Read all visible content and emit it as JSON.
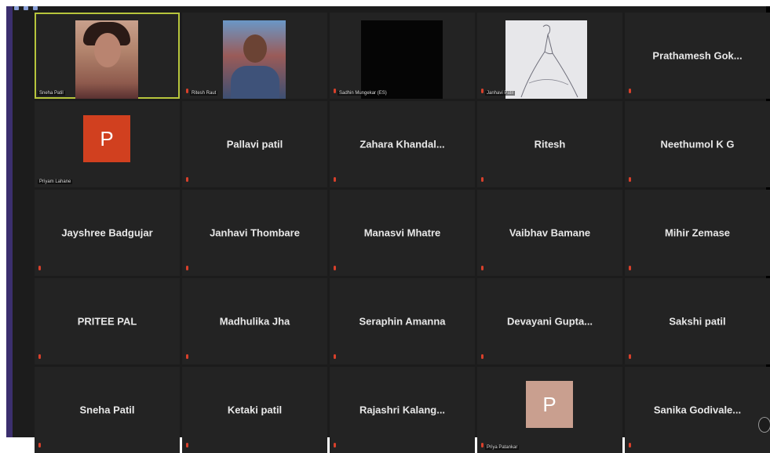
{
  "participants": [
    {
      "name": "",
      "label": "Sneha Patil",
      "type": "video",
      "video": "face",
      "active": true,
      "muted": false
    },
    {
      "name": "",
      "label": "Ritesh Raut",
      "type": "video",
      "video": "man",
      "active": false,
      "muted": true
    },
    {
      "name": "",
      "label": "Sadhin Mungekar (ES)",
      "type": "video",
      "video": "black",
      "active": false,
      "muted": true
    },
    {
      "name": "",
      "label": "Janhavi Patil",
      "type": "video",
      "video": "sketch",
      "active": false,
      "muted": true
    },
    {
      "name": "Prathamesh Gok...",
      "label": "",
      "type": "name",
      "muted": true
    },
    {
      "name": "",
      "label": "Priyam Lahane",
      "type": "avatar",
      "avatar_letter": "P",
      "avatar_color": "#d1401f",
      "muted": false
    },
    {
      "name": "Pallavi patil",
      "label": "",
      "type": "name",
      "muted": true
    },
    {
      "name": "Zahara Khandal...",
      "label": "",
      "type": "name",
      "muted": true
    },
    {
      "name": "Ritesh",
      "label": "",
      "type": "name",
      "muted": true
    },
    {
      "name": "Neethumol K G",
      "label": "",
      "type": "name",
      "muted": true
    },
    {
      "name": "Jayshree Badgujar",
      "label": "",
      "type": "name",
      "muted": true
    },
    {
      "name": "Janhavi Thombare",
      "label": "",
      "type": "name",
      "muted": true
    },
    {
      "name": "Manasvi Mhatre",
      "label": "",
      "type": "name",
      "muted": true
    },
    {
      "name": "Vaibhav Bamane",
      "label": "",
      "type": "name",
      "muted": true
    },
    {
      "name": "Mihir Zemase",
      "label": "",
      "type": "name",
      "muted": true
    },
    {
      "name": "PRITEE PAL",
      "label": "",
      "type": "name",
      "muted": true
    },
    {
      "name": "Madhulika Jha",
      "label": "",
      "type": "name",
      "muted": true
    },
    {
      "name": "Seraphin Amanna",
      "label": "",
      "type": "name",
      "muted": true
    },
    {
      "name": "Devayani Gupta...",
      "label": "",
      "type": "name",
      "muted": true
    },
    {
      "name": "Sakshi patil",
      "label": "",
      "type": "name",
      "muted": true
    },
    {
      "name": "Sneha Patil",
      "label": "",
      "type": "name",
      "muted": true
    },
    {
      "name": "Ketaki patil",
      "label": "",
      "type": "name",
      "muted": true
    },
    {
      "name": "Rajashri Kalang...",
      "label": "",
      "type": "name",
      "muted": true
    },
    {
      "name": "",
      "label": "Priya Patankar",
      "type": "avatar",
      "avatar_letter": "P",
      "avatar_color": "#c99f8f",
      "muted": true
    },
    {
      "name": "Sanika Godivale...",
      "label": "",
      "type": "name",
      "muted": true
    }
  ],
  "colors": {
    "background": "#1c1c1c",
    "tile": "#232323",
    "active_border": "#b7c53c",
    "mute": "#d9402b"
  }
}
